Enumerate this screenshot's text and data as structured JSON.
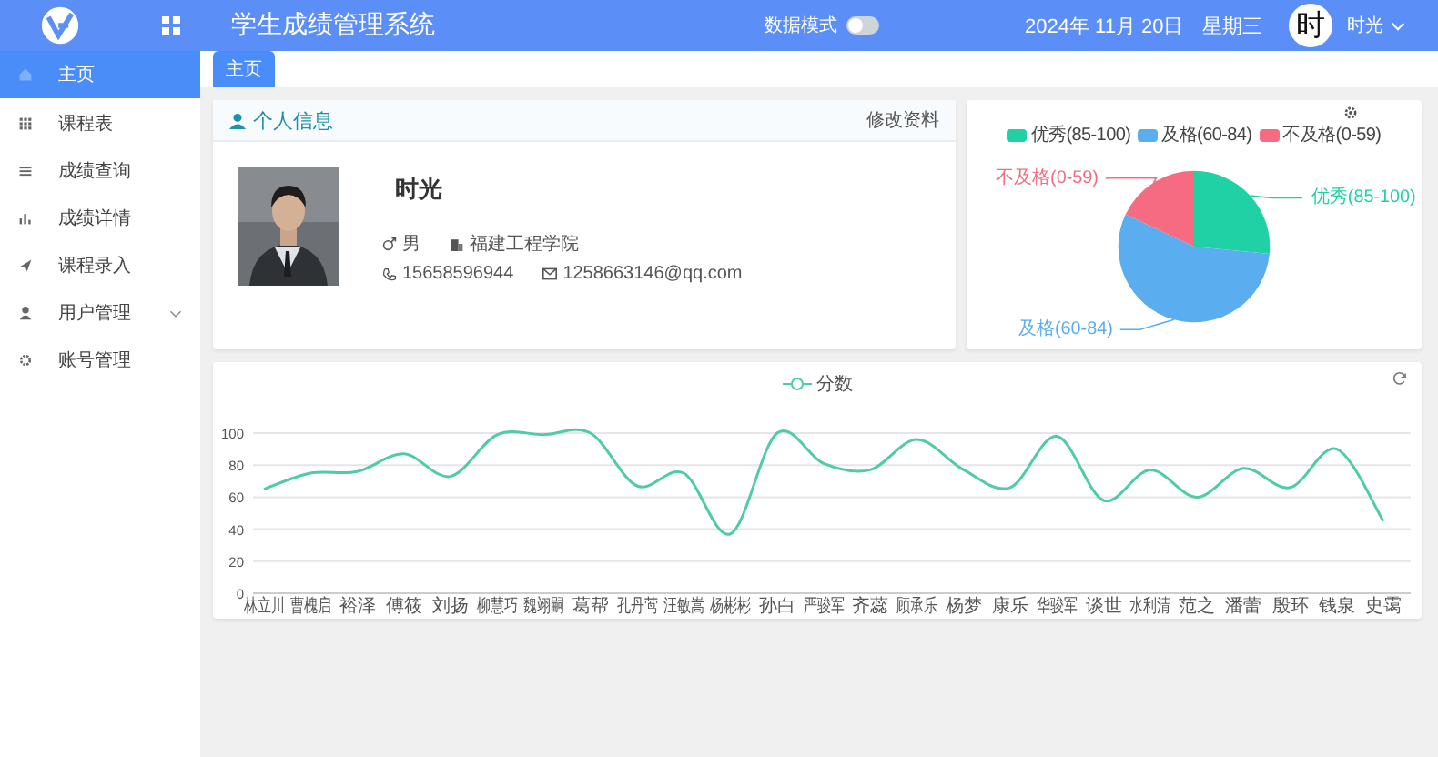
{
  "header": {
    "title": "学生成绩管理系统",
    "mode_label": "数据模式",
    "mode_switch": {
      "on": false
    },
    "date": "2024年 11月 20日",
    "weekday": "星期三",
    "avatar_char": "时",
    "user": "时光"
  },
  "sidebar": {
    "items": [
      {
        "label": "主页",
        "kind": "link",
        "selected": true
      },
      {
        "label": "课程表",
        "kind": "link",
        "selected": false
      },
      {
        "label": "成绩查询",
        "kind": "link",
        "selected": false
      },
      {
        "label": "成绩详情",
        "kind": "link",
        "selected": false
      },
      {
        "label": "课程录入",
        "kind": "link",
        "selected": false
      },
      {
        "label": "用户管理",
        "kind": "group",
        "selected": false,
        "expanded": false
      },
      {
        "label": "账号管理",
        "kind": "link",
        "selected": false
      }
    ]
  },
  "tabs": [
    {
      "label": "主页",
      "selected": true
    }
  ],
  "profile": {
    "title": "个人信息",
    "edit_link": "修改资料",
    "name": "时光",
    "gender": "男",
    "school": "福建工程学院",
    "phone": "15658596944",
    "email": "1258663146@qq.com"
  },
  "pie": {
    "legend": [
      {
        "label": "优秀(85-100)",
        "color": "#1fd1a5"
      },
      {
        "label": "及格(60-84)",
        "color": "#5aaef0"
      },
      {
        "label": "不及格(0-59)",
        "color": "#f56c82"
      }
    ],
    "slices": [
      {
        "label": "优秀(85-100)",
        "color": "#1fd1a5"
      },
      {
        "label": "及格(60-84)",
        "color": "#5aaef0"
      },
      {
        "label": "不及格(0-59)",
        "color": "#f56c82"
      }
    ]
  },
  "scores": {
    "chart_data": {
      "type": "line",
      "categories": [
        "林立川",
        "曹槐启",
        "裕泽",
        "傅筱",
        "刘扬",
        "柳慧巧",
        "魏翊嗣",
        "葛帮",
        "孔丹莺",
        "汪敏嵩",
        "杨彬彬",
        "孙白",
        "严骏军",
        "齐蕊",
        "顾承乐",
        "杨梦",
        "康乐",
        "华骏军",
        "谈世",
        "水利清",
        "范之",
        "潘蕾",
        "殷环",
        "钱泉",
        "史霭"
      ],
      "series": [
        {
          "name": "分数",
          "color": "#4ecba8",
          "values": [
            65,
            75,
            76,
            87,
            73,
            99,
            99,
            100,
            67,
            75,
            37,
            100,
            81,
            77,
            96,
            77,
            66,
            98,
            58,
            77,
            60,
            78,
            66,
            90,
            45
          ]
        }
      ],
      "ylim": [
        0,
        100
      ],
      "yticks": [
        0,
        20,
        40,
        60,
        80,
        100
      ],
      "grid": true
    }
  }
}
